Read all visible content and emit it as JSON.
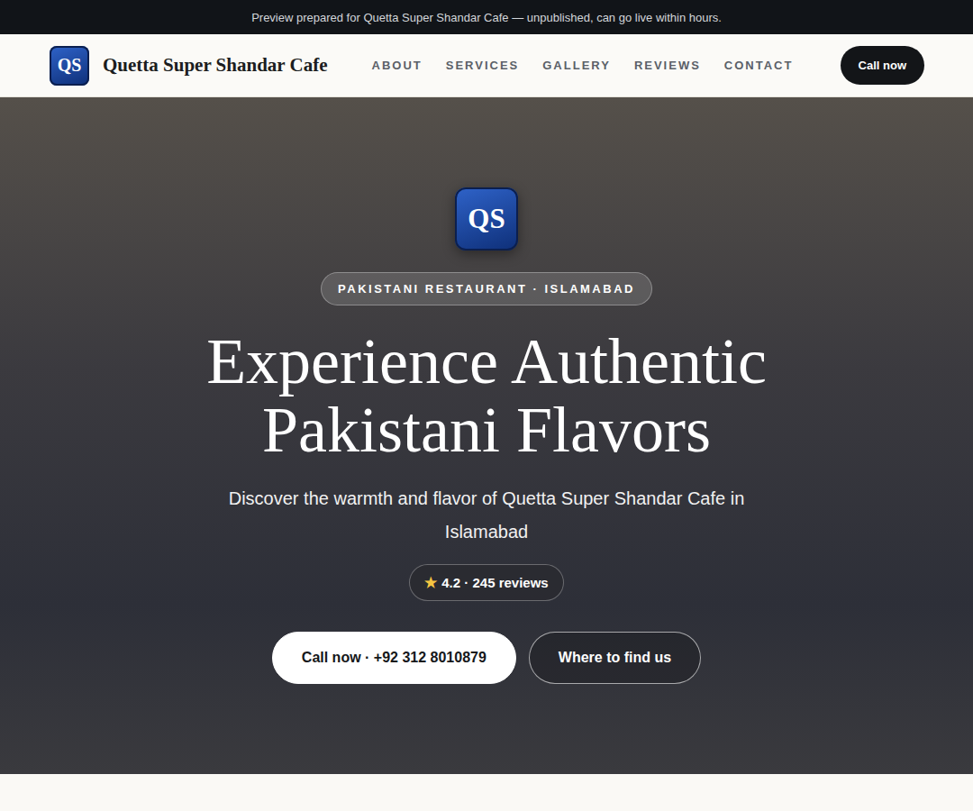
{
  "banner": {
    "text": "Preview prepared for Quetta Super Shandar Cafe — unpublished, can go live within hours."
  },
  "header": {
    "logo": "QS",
    "name": "Quetta Super Shandar Cafe",
    "nav": [
      {
        "label": "ABOUT"
      },
      {
        "label": "SERVICES"
      },
      {
        "label": "GALLERY"
      },
      {
        "label": "REVIEWS"
      },
      {
        "label": "CONTACT"
      }
    ],
    "cta": "Call now"
  },
  "hero": {
    "logo": "QS",
    "badge": "PAKISTANI RESTAURANT · ISLAMABAD",
    "title_lines": [
      "Experience Authentic",
      "Pakistani Flavors"
    ],
    "subtitle": "Discover the warmth and flavor of Quetta Super Shandar Cafe in Islamabad",
    "rating": {
      "icon": "★",
      "text": "4.2 · 245 reviews"
    },
    "buttons": [
      {
        "label": "Call now · +92 312 8010879",
        "kind": "primary"
      },
      {
        "label": "Where to find us",
        "kind": "outline"
      }
    ]
  }
}
